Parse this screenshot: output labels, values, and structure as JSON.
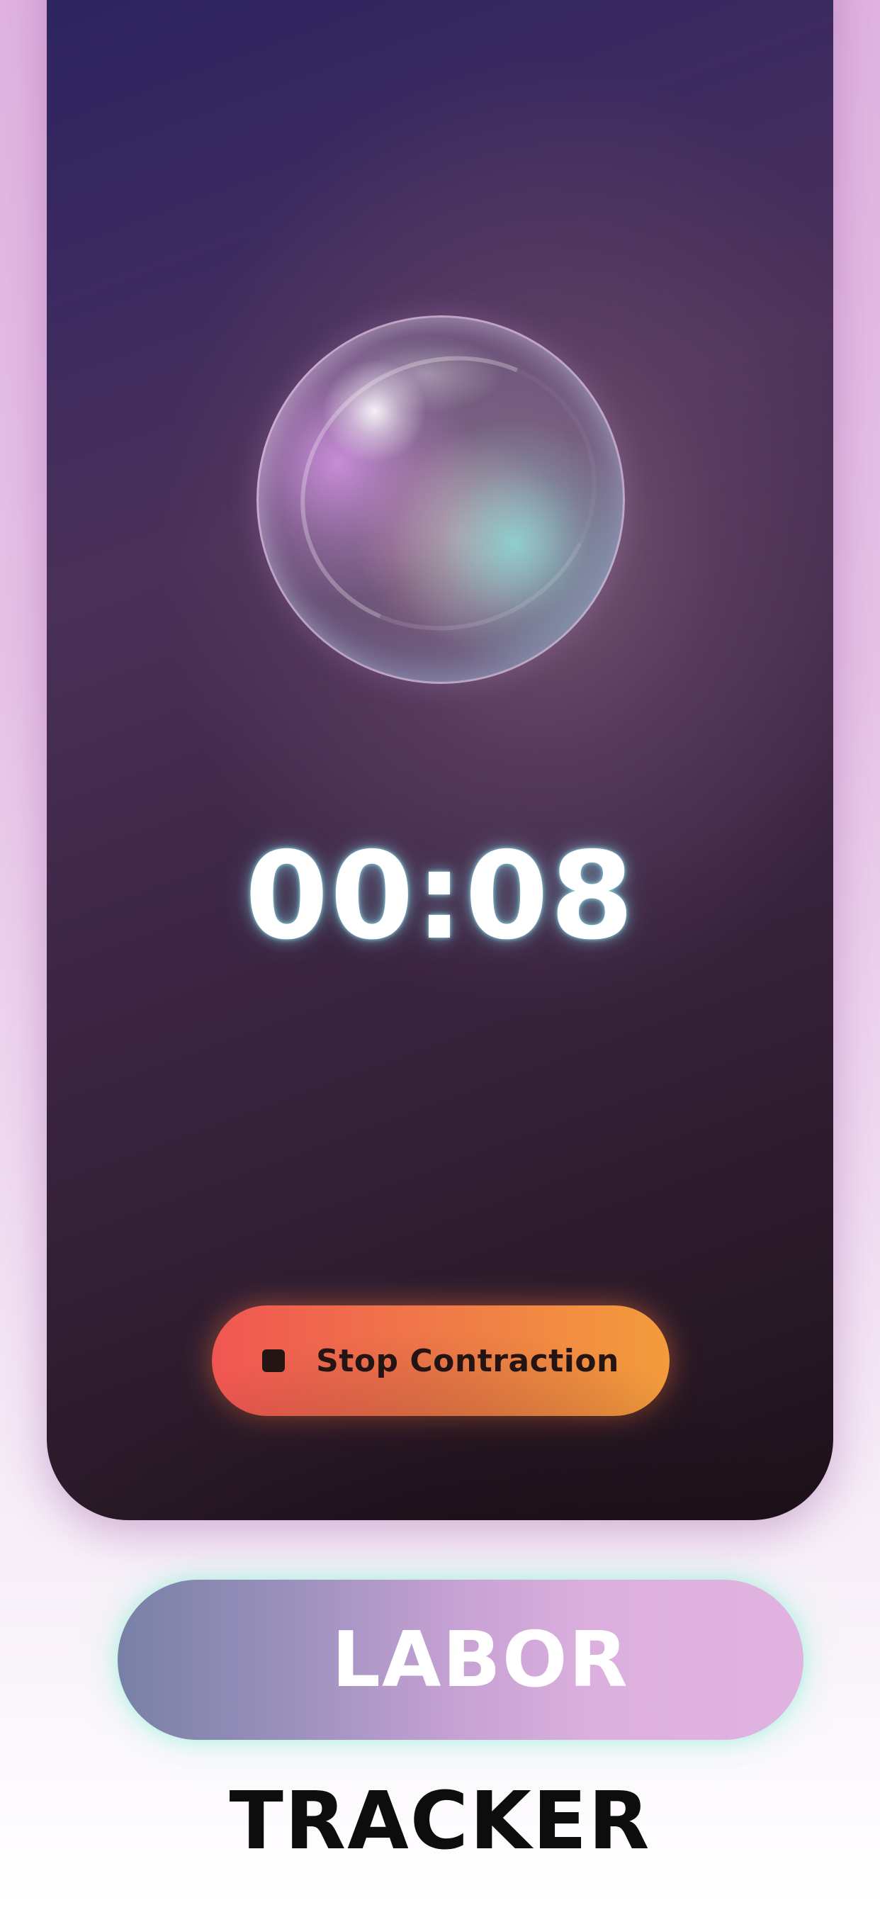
{
  "timer": {
    "display": "00:08"
  },
  "actions": {
    "stop_label": "Stop Contraction",
    "stop_icon": "stop-square-icon"
  },
  "branding": {
    "title_top": "LABOR",
    "title_bottom": "TRACKER"
  },
  "colors": {
    "stop_gradient_start": "#f05652",
    "stop_gradient_end": "#f39c3c",
    "pill_gradient_start": "#7880a6",
    "pill_gradient_end": "#e0b2e0",
    "timer_glow": "#8cdceb"
  }
}
